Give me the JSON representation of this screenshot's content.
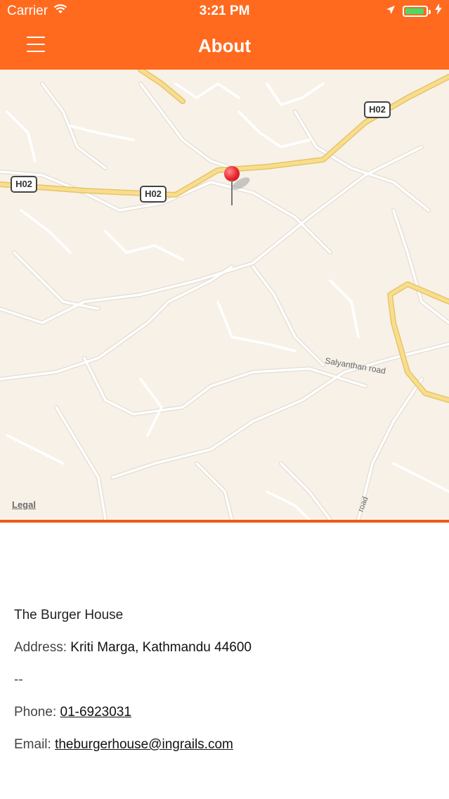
{
  "status_bar": {
    "carrier": "Carrier",
    "time": "3:21 PM",
    "icons": [
      "wifi-icon",
      "location-arrow-icon",
      "battery-icon",
      "charging-bolt-icon"
    ]
  },
  "nav": {
    "title": "About",
    "menu_icon": "hamburger-menu-icon"
  },
  "map": {
    "route_labels": [
      "H02",
      "H02",
      "H02"
    ],
    "road_label_1": "Salyanthan road",
    "road_label_2": "road",
    "legal": "Legal",
    "colors": {
      "background": "#F7F1E8",
      "roads": "#FFFFFF",
      "highway": "#F5D77E",
      "pin": "#E8232B"
    }
  },
  "details": {
    "name": "The Burger House",
    "address_label": "Address:",
    "address_value": "Kriti Marga, Kathmandu 44600",
    "separator": "--",
    "phone_label": "Phone:",
    "phone_value": "01-6923031",
    "email_label": "Email:",
    "email_value": "theburgerhouse@ingrails.com"
  },
  "colors": {
    "accent": "#FF6A1F",
    "divider": "#F05A16"
  }
}
